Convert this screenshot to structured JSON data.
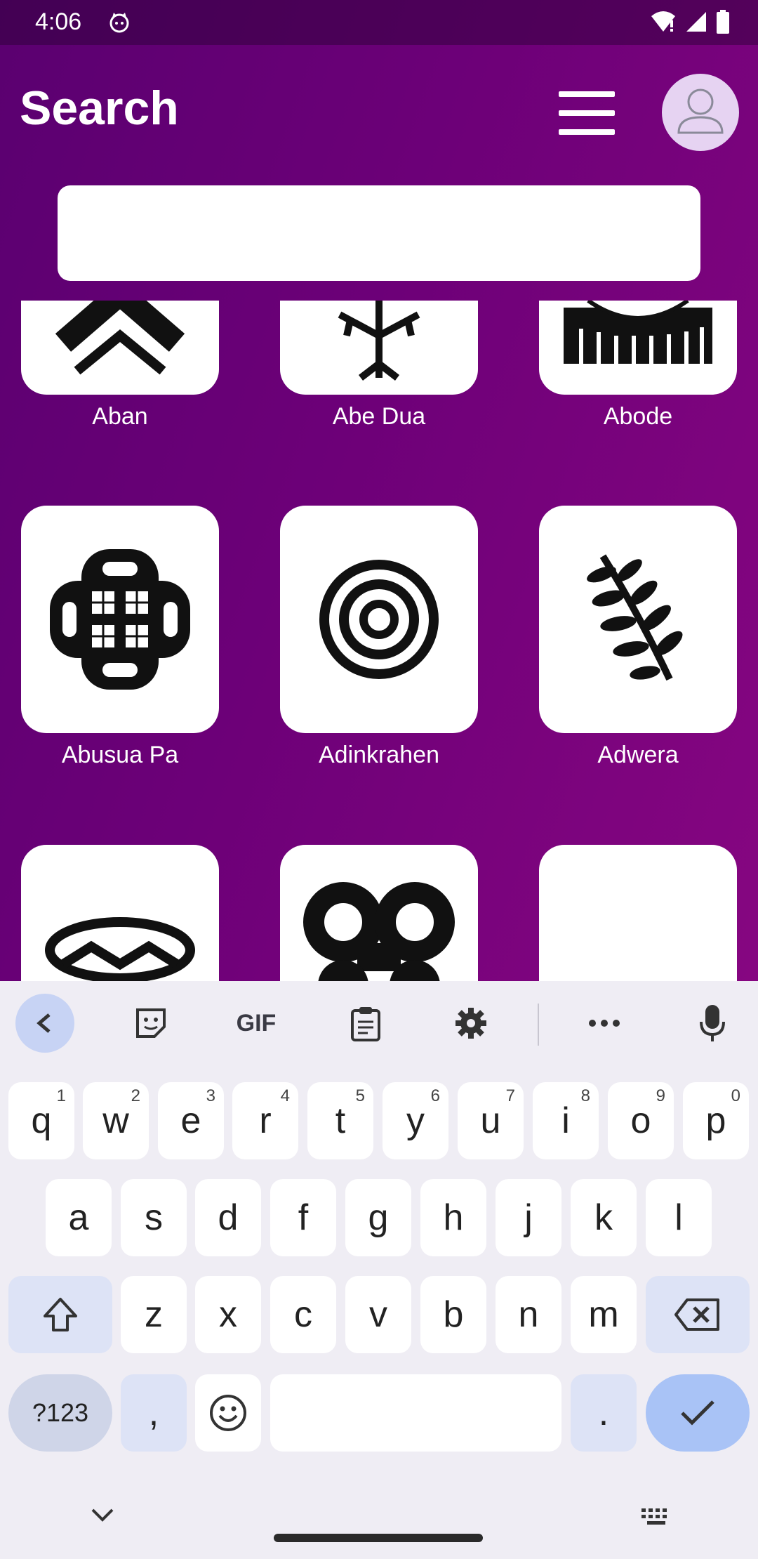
{
  "status_bar": {
    "time": "4:06"
  },
  "header": {
    "title": "Search"
  },
  "search": {
    "value": "",
    "placeholder": ""
  },
  "symbols": [
    {
      "name": "Aban"
    },
    {
      "name": "Abe Dua"
    },
    {
      "name": "Abode"
    },
    {
      "name": "Abusua Pa"
    },
    {
      "name": "Adinkrahen"
    },
    {
      "name": "Adwera"
    },
    {
      "name": ""
    },
    {
      "name": ""
    },
    {
      "name": ""
    }
  ],
  "keyboard": {
    "toolbar": [
      "back-icon",
      "sticker-icon",
      "GIF",
      "clipboard-icon",
      "settings-icon",
      "more-icon",
      "mic-icon"
    ],
    "gif_label": "GIF",
    "rows": [
      [
        "q",
        "w",
        "e",
        "r",
        "t",
        "y",
        "u",
        "i",
        "o",
        "p"
      ],
      [
        "a",
        "s",
        "d",
        "f",
        "g",
        "h",
        "j",
        "k",
        "l"
      ],
      [
        "z",
        "x",
        "c",
        "v",
        "b",
        "n",
        "m"
      ]
    ],
    "hints": [
      "1",
      "2",
      "3",
      "4",
      "5",
      "6",
      "7",
      "8",
      "9",
      "0"
    ],
    "symbols_label": "?123",
    "comma": ",",
    "period": "."
  },
  "colors": {
    "accent": "#6d0078",
    "keyboard_bg": "#efedf4",
    "enter": "#a9c3f6"
  }
}
